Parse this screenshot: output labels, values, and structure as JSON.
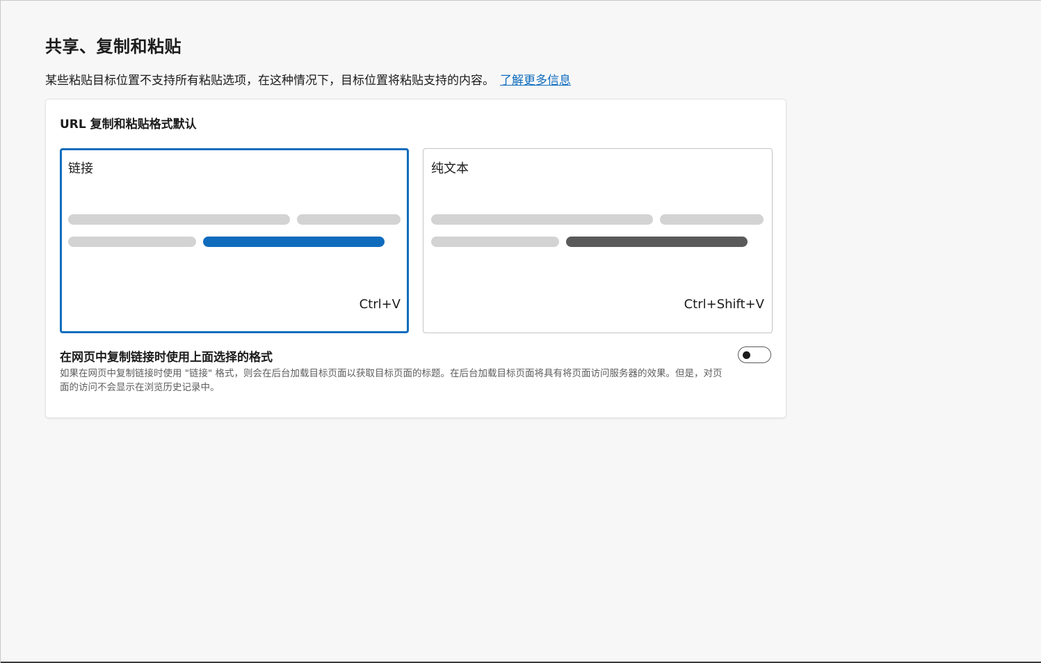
{
  "page": {
    "title": "共享、复制和粘贴",
    "description": "某些粘贴目标位置不支持所有粘贴选项，在这种情况下，目标位置将粘贴支持的内容。",
    "learn_more": "了解更多信息"
  },
  "card": {
    "title": "URL 复制和粘贴格式默认",
    "options": [
      {
        "label": "链接",
        "shortcut": "Ctrl+V",
        "selected": true
      },
      {
        "label": "纯文本",
        "shortcut": "Ctrl+Shift+V",
        "selected": false
      }
    ],
    "setting": {
      "title": "在网页中复制链接时使用上面选择的格式",
      "description": "如果在网页中复制链接时使用 \"链接\" 格式，则会在后台加载目标页面以获取目标页面的标题。在后台加载目标页面将具有将页面访问服务器的效果。但是，对页面的访问不会显示在浏览历史记录中。",
      "enabled": false
    }
  },
  "colors": {
    "accent": "#0f6cbd",
    "placeholder_bar": "#d3d3d3",
    "plain_text_bar": "#5a5a5a",
    "background": "#f7f7f7",
    "card": "#ffffff"
  }
}
